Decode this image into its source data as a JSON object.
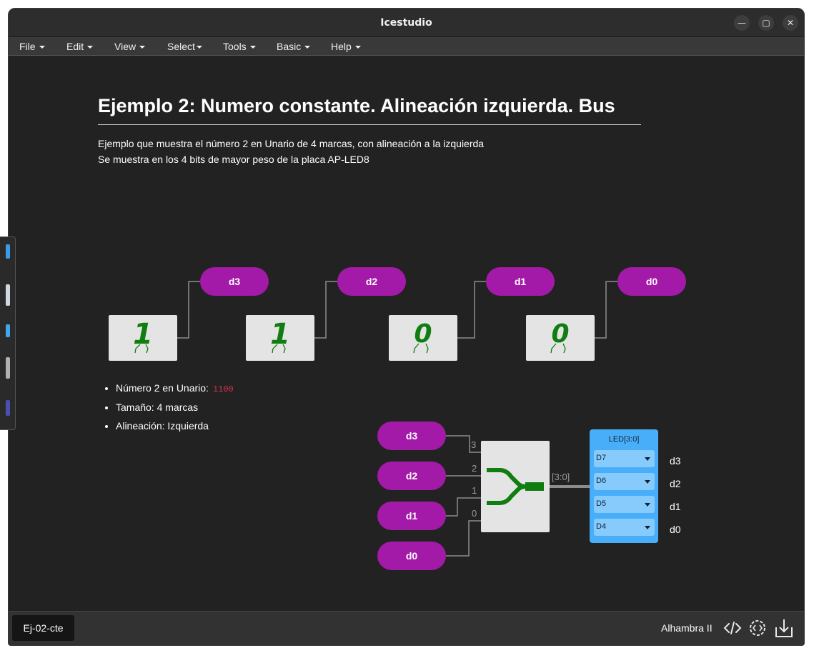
{
  "window": {
    "title": "Icestudio"
  },
  "window_controls": {
    "minimize": "—",
    "maximize": "▢",
    "close": "✕"
  },
  "menu": [
    "File",
    "Edit",
    "View",
    "Select",
    "Tools",
    "Basic",
    "Help"
  ],
  "info": {
    "title": "Ejemplo 2: Numero constante. Alineación izquierda. Bus",
    "line1": "Ejemplo que muestra el número 2 en Unario de 4 marcas, con alineación a la izquierda",
    "line2": "Se muestra en los 4 bits de mayor peso de la placa AP-LED8"
  },
  "labels_top": [
    "d3",
    "d2",
    "d1",
    "d0"
  ],
  "constants": [
    "1",
    "1",
    "0",
    "0"
  ],
  "props": {
    "item1_label": "Número 2 en Unario:",
    "item1_code": "1100",
    "item2": "Tamaño: 4 marcas",
    "item3": "Alineación: Izquierda"
  },
  "labels_inputs": [
    "d3",
    "d2",
    "d1",
    "d0"
  ],
  "bus_wire_numbers": [
    "3",
    "2",
    "1",
    "0"
  ],
  "bus_label": "[3:0]",
  "led": {
    "title": "LED[3:0]",
    "pins": [
      "D7",
      "D6",
      "D5",
      "D4"
    ],
    "names": [
      "d3",
      "d2",
      "d1",
      "d0"
    ]
  },
  "footer": {
    "file_tab": "Ej-02-cte",
    "board": "Alhambra II",
    "icons": [
      "code-icon",
      "settings-code-icon",
      "download-icon"
    ]
  },
  "colors": {
    "label": "#a21aa7",
    "block": "#e4e4e4",
    "led": "#49aefa",
    "green": "#0f7d0f"
  }
}
